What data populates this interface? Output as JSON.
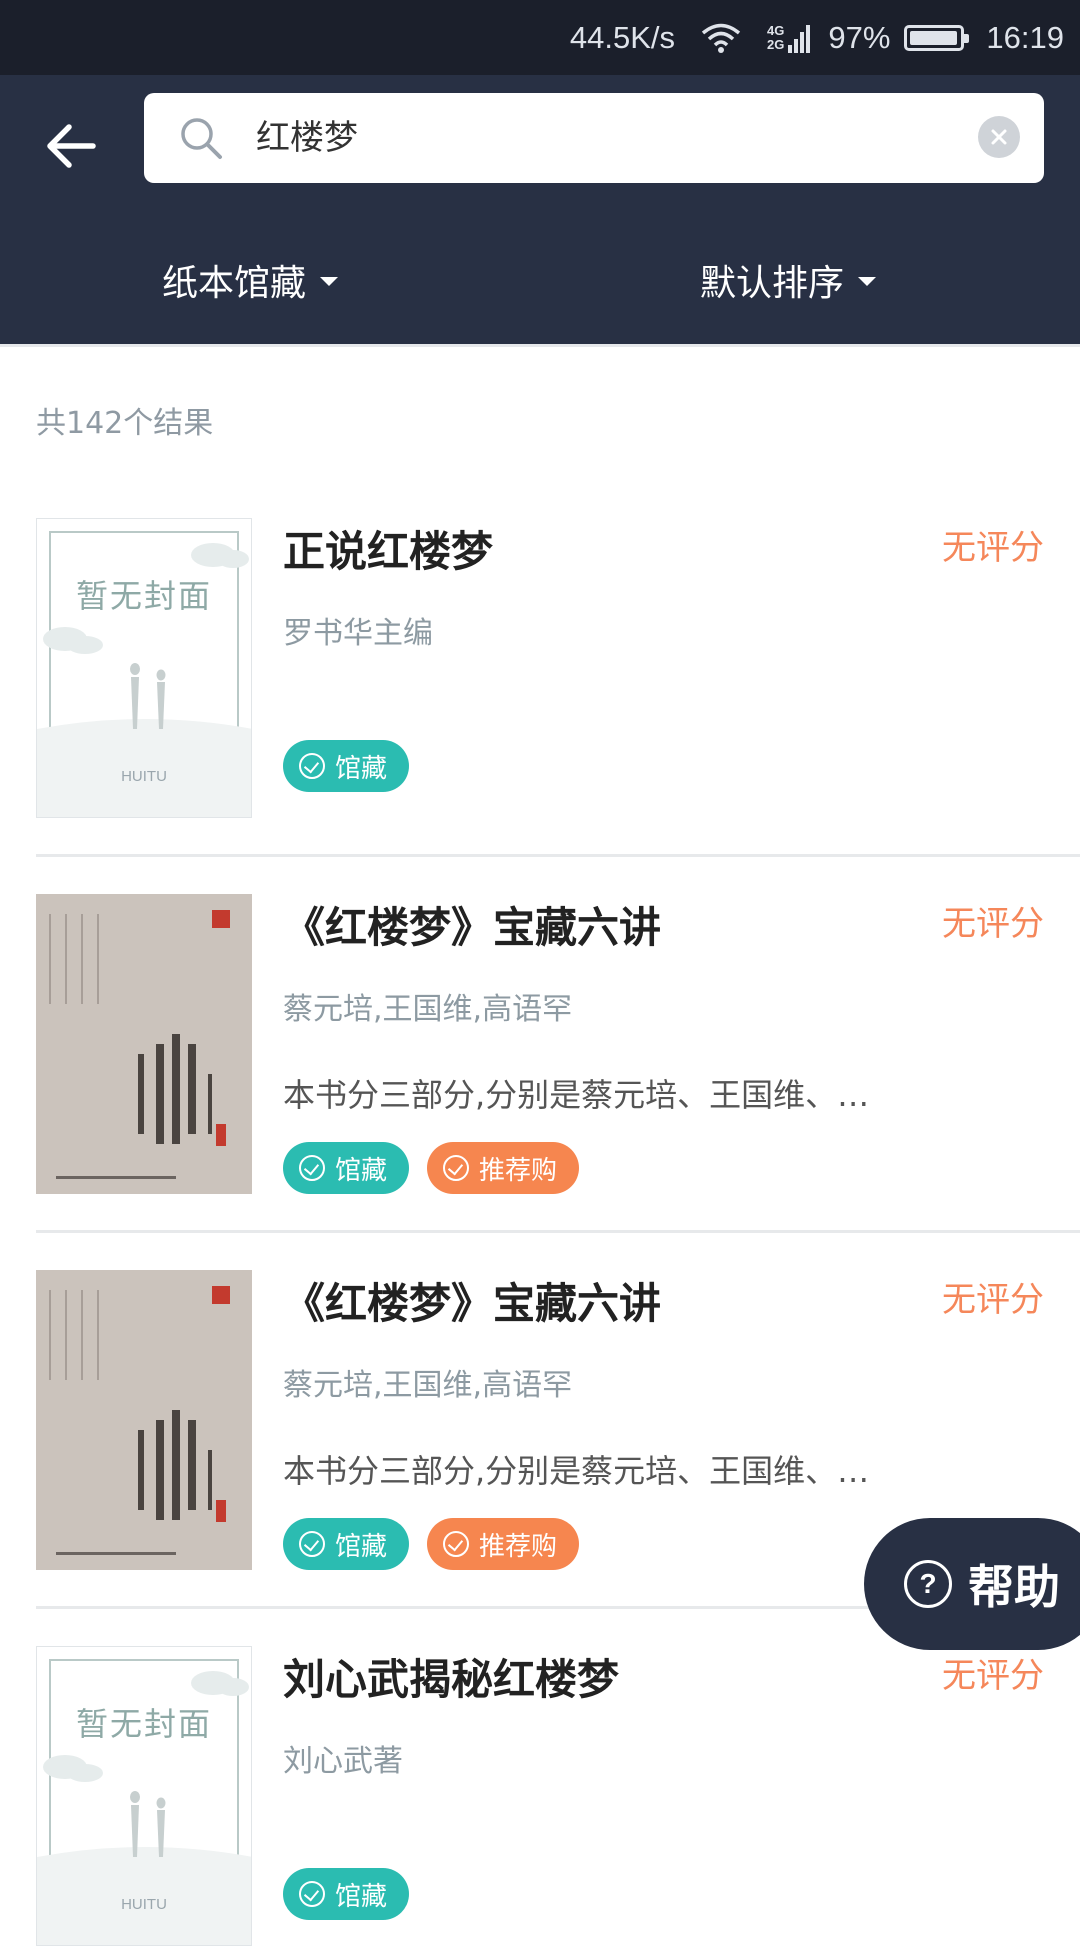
{
  "status_bar": {
    "net_speed": "44.5K/s",
    "net_badge_top": "4G",
    "net_badge_bottom": "2G",
    "battery": "97%",
    "battery_level": 0.97,
    "time": "16:19"
  },
  "search": {
    "query": "红楼梦"
  },
  "filters": {
    "collection": "纸本馆藏",
    "sort": "默认排序"
  },
  "result_count": "共142个结果",
  "results": [
    {
      "title": "正说红楼梦",
      "rating": "无评分",
      "author": "罗书华主编",
      "summary": "",
      "cover_text": "暂无封面",
      "cover_brand": "HUITU",
      "tags": [
        "馆藏"
      ]
    },
    {
      "title": "《红楼梦》宝藏六讲",
      "rating": "无评分",
      "author": "蔡元培,王国维,高语罕",
      "summary": "本书分三部分,分别是蔡元培、王国维、…",
      "tags": [
        "馆藏",
        "推荐购"
      ]
    },
    {
      "title": "《红楼梦》宝藏六讲",
      "rating": "无评分",
      "author": "蔡元培,王国维,高语罕",
      "summary": "本书分三部分,分别是蔡元培、王国维、…",
      "tags": [
        "馆藏",
        "推荐购"
      ]
    },
    {
      "title": "刘心武揭秘红楼梦",
      "rating": "无评分",
      "author": "刘心武著",
      "summary": "",
      "cover_text": "暂无封面",
      "cover_brand": "HUITU",
      "tags": [
        "馆藏"
      ]
    }
  ],
  "help_button": "帮助",
  "colors": {
    "header_bg": "#283044",
    "status_bg": "#1b1f2b",
    "tag_green": "#2bbcb1",
    "tag_orange": "#f6864f",
    "rating_orange": "#f5875a"
  }
}
